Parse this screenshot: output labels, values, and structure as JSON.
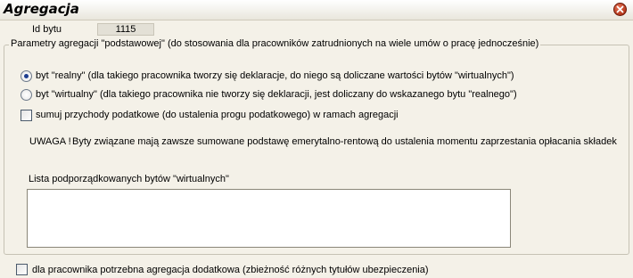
{
  "window": {
    "title": "Agregacja"
  },
  "id": {
    "label": "Id bytu",
    "value": "1115"
  },
  "group": {
    "legend": "Parametry agregacji \"podstawowej\" (do stosowania dla pracowników zatrudnionych na wiele umów o pracę jednocześnie)"
  },
  "options": {
    "real": {
      "label": "byt \"realny\" (dla takiego pracownika tworzy się deklaracje, do niego są doliczane wartości bytów \"wirtualnych\")",
      "selected": true
    },
    "virtual": {
      "label": "byt \"wirtualny\" (dla takiego pracownika nie tworzy się deklaracji, jest doliczany do wskazanego bytu \"realnego\")",
      "selected": false
    }
  },
  "sum_income": {
    "label": "sumuj przychody podatkowe (do ustalenia progu podatkowego) w ramach agregacji",
    "checked": false
  },
  "warning": {
    "prefix": "UWAGA !",
    "text": "Byty związane mają zawsze sumowane podstawę emerytalno-rentową do ustalenia momentu zaprzestania opłacania składek"
  },
  "virtual_list": {
    "label": "Lista podporządkowanych bytów \"wirtualnych\"",
    "items": []
  },
  "additional": {
    "label": "dla pracownika potrzebna agregacja dodatkowa (zbieżność różnych tytułów ubezpieczenia)",
    "checked": false
  }
}
